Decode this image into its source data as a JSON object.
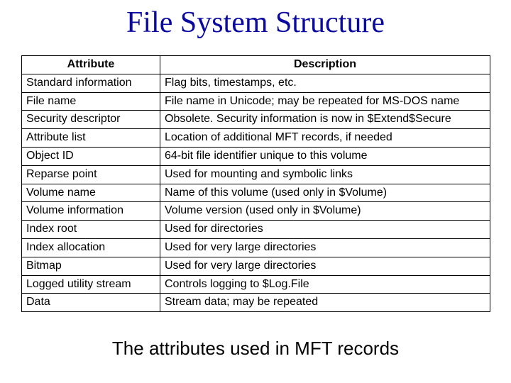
{
  "title": "File System Structure",
  "caption": "The attributes used in MFT records",
  "table": {
    "headers": {
      "attribute": "Attribute",
      "description": "Description"
    },
    "rows": [
      {
        "attr": "Standard information",
        "desc": "Flag bits, timestamps, etc."
      },
      {
        "attr": "File name",
        "desc": "File name in Unicode; may be repeated for MS-DOS name"
      },
      {
        "attr": "Security descriptor",
        "desc": "Obsolete. Security information is now in $Extend$Secure"
      },
      {
        "attr": "Attribute list",
        "desc": "Location of additional MFT records, if needed"
      },
      {
        "attr": "Object ID",
        "desc": "64-bit file identifier unique to this volume"
      },
      {
        "attr": "Reparse point",
        "desc": "Used for mounting and symbolic links"
      },
      {
        "attr": "Volume name",
        "desc": "Name of this volume (used only in $Volume)"
      },
      {
        "attr": "Volume information",
        "desc": "Volume version (used only in $Volume)"
      },
      {
        "attr": "Index root",
        "desc": "Used for directories"
      },
      {
        "attr": "Index allocation",
        "desc": "Used for very large directories"
      },
      {
        "attr": "Bitmap",
        "desc": "Used for very large directories"
      },
      {
        "attr": "Logged utility stream",
        "desc": "Controls logging to $Log.File"
      },
      {
        "attr": "Data",
        "desc": "Stream data; may be repeated"
      }
    ]
  }
}
